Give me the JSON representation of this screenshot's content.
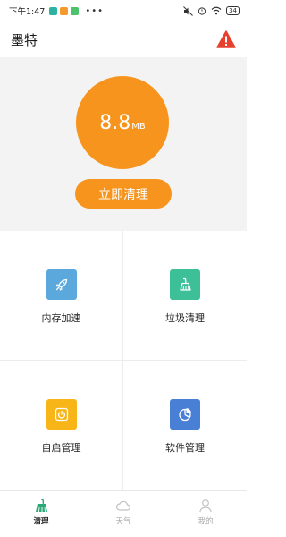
{
  "status_bar": {
    "time": "下午1:47",
    "dots": "•••",
    "battery": "34"
  },
  "header": {
    "title": "墨特"
  },
  "hero": {
    "value": "8.8",
    "unit": "MB",
    "button_label": "立即清理"
  },
  "features": [
    {
      "label": "内存加速",
      "icon": "rocket-icon",
      "color": "#5aa8dc"
    },
    {
      "label": "垃圾清理",
      "icon": "broom-icon",
      "color": "#3dbf98"
    },
    {
      "label": "自启管理",
      "icon": "power-icon",
      "color": "#f7b517"
    },
    {
      "label": "软件管理",
      "icon": "pie-chart-icon",
      "color": "#4a7fd6"
    }
  ],
  "bottom_nav": [
    {
      "label": "清理",
      "icon": "broom-nav-icon",
      "active": true
    },
    {
      "label": "天气",
      "icon": "cloud-icon",
      "active": false
    },
    {
      "label": "我的",
      "icon": "user-icon",
      "active": false
    }
  ],
  "colors": {
    "accent": "#f7941d",
    "alert": "#e8402e",
    "active_tab": "#2aa876"
  }
}
